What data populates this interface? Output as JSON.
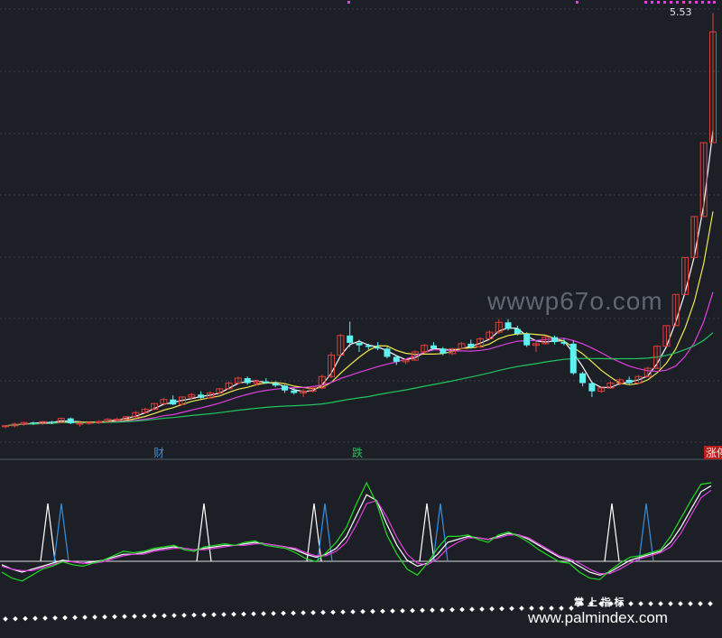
{
  "chart_data": [
    {
      "type": "candlestick",
      "price_label": "5.53",
      "event_labels": [
        {
          "text": "财",
          "color": "#3a8fd8"
        },
        {
          "text": "跌",
          "color": "#22c55e"
        },
        {
          "text": "涨停",
          "color": "#f2f2f2",
          "bg": "#b91c1c"
        }
      ],
      "colors": {
        "up": "#e0403a",
        "down": "#5ff0f0",
        "ma_white": "#ffffff",
        "ma_yellow": "#f2e94e",
        "ma_magenta": "#e040e0",
        "ma_green": "#22c55e"
      },
      "grid": true,
      "candles": [
        [
          0.5,
          0.51,
          0.47,
          0.5
        ],
        [
          0.5,
          0.54,
          0.48,
          0.52
        ],
        [
          0.52,
          0.55,
          0.5,
          0.54
        ],
        [
          0.54,
          0.55,
          0.51,
          0.53
        ],
        [
          0.53,
          0.56,
          0.51,
          0.55
        ],
        [
          0.55,
          0.56,
          0.52,
          0.54
        ],
        [
          0.54,
          0.6,
          0.53,
          0.59
        ],
        [
          0.59,
          0.6,
          0.52,
          0.53
        ],
        [
          0.53,
          0.55,
          0.49,
          0.53
        ],
        [
          0.53,
          0.55,
          0.51,
          0.54
        ],
        [
          0.54,
          0.57,
          0.52,
          0.55
        ],
        [
          0.55,
          0.59,
          0.54,
          0.58
        ],
        [
          0.58,
          0.6,
          0.57,
          0.58
        ],
        [
          0.58,
          0.62,
          0.58,
          0.61
        ],
        [
          0.61,
          0.68,
          0.6,
          0.66
        ],
        [
          0.66,
          0.72,
          0.65,
          0.7
        ],
        [
          0.7,
          0.78,
          0.69,
          0.77
        ],
        [
          0.77,
          0.84,
          0.75,
          0.82
        ],
        [
          0.82,
          0.87,
          0.75,
          0.76
        ],
        [
          0.76,
          0.86,
          0.75,
          0.85
        ],
        [
          0.85,
          0.9,
          0.82,
          0.88
        ],
        [
          0.88,
          0.92,
          0.83,
          0.84
        ],
        [
          0.84,
          0.92,
          0.83,
          0.9
        ],
        [
          0.9,
          0.96,
          0.89,
          0.95
        ],
        [
          0.95,
          1.04,
          0.94,
          1.02
        ],
        [
          1.02,
          1.1,
          1.01,
          1.08
        ],
        [
          1.08,
          1.1,
          1.0,
          1.02
        ],
        [
          1.02,
          1.06,
          0.99,
          1.04
        ],
        [
          1.04,
          1.08,
          1.01,
          1.02
        ],
        [
          1.02,
          1.04,
          0.97,
          0.99
        ],
        [
          0.99,
          1.0,
          0.9,
          0.93
        ],
        [
          0.93,
          0.96,
          0.88,
          0.9
        ],
        [
          0.9,
          0.95,
          0.85,
          0.92
        ],
        [
          0.92,
          0.98,
          0.91,
          0.96
        ],
        [
          0.96,
          1.12,
          0.95,
          1.1
        ],
        [
          1.1,
          1.4,
          1.08,
          1.36
        ],
        [
          1.36,
          1.62,
          1.35,
          1.6
        ],
        [
          1.6,
          1.77,
          1.46,
          1.51
        ],
        [
          1.51,
          1.55,
          1.4,
          1.48
        ],
        [
          1.48,
          1.5,
          1.43,
          1.46
        ],
        [
          1.46,
          1.52,
          1.42,
          1.44
        ],
        [
          1.44,
          1.46,
          1.32,
          1.34
        ],
        [
          1.34,
          1.36,
          1.24,
          1.28
        ],
        [
          1.28,
          1.32,
          1.25,
          1.3
        ],
        [
          1.3,
          1.42,
          1.29,
          1.4
        ],
        [
          1.4,
          1.5,
          1.38,
          1.48
        ],
        [
          1.48,
          1.52,
          1.43,
          1.44
        ],
        [
          1.44,
          1.46,
          1.36,
          1.38
        ],
        [
          1.38,
          1.45,
          1.36,
          1.44
        ],
        [
          1.44,
          1.52,
          1.43,
          1.5
        ],
        [
          1.5,
          1.55,
          1.44,
          1.46
        ],
        [
          1.46,
          1.58,
          1.45,
          1.56
        ],
        [
          1.56,
          1.66,
          1.55,
          1.64
        ],
        [
          1.64,
          1.8,
          1.62,
          1.76
        ],
        [
          1.76,
          1.8,
          1.66,
          1.68
        ],
        [
          1.68,
          1.72,
          1.6,
          1.62
        ],
        [
          1.62,
          1.64,
          1.46,
          1.48
        ],
        [
          1.48,
          1.52,
          1.4,
          1.5
        ],
        [
          1.5,
          1.6,
          1.49,
          1.58
        ],
        [
          1.58,
          1.6,
          1.49,
          1.52
        ],
        [
          1.52,
          1.56,
          1.48,
          1.5
        ],
        [
          1.5,
          1.54,
          1.12,
          1.14
        ],
        [
          1.14,
          1.16,
          0.98,
          1.02
        ],
        [
          1.02,
          1.04,
          0.85,
          0.92
        ],
        [
          0.92,
          0.98,
          0.9,
          0.96
        ],
        [
          0.96,
          1.04,
          0.95,
          1.02
        ],
        [
          1.02,
          1.08,
          0.99,
          1.06
        ],
        [
          1.06,
          1.1,
          1.0,
          1.02
        ],
        [
          1.02,
          1.12,
          1.01,
          1.1
        ],
        [
          1.1,
          1.22,
          1.09,
          1.2
        ],
        [
          1.2,
          1.48,
          1.19,
          1.47
        ],
        [
          1.47,
          1.72,
          1.47,
          1.72
        ],
        [
          1.72,
          2.1,
          1.72,
          2.1
        ],
        [
          2.1,
          2.55,
          2.1,
          2.55
        ],
        [
          2.55,
          3.05,
          2.55,
          3.05
        ],
        [
          3.05,
          3.95,
          3.05,
          3.95
        ],
        [
          3.95,
          5.53,
          3.95,
          5.3
        ]
      ],
      "kdj": {
        "k": [
          45,
          42,
          40,
          42,
          44,
          46,
          48,
          47,
          46,
          47,
          48,
          50,
          52,
          52,
          53,
          55,
          56,
          57,
          56,
          55,
          56,
          57,
          58,
          58,
          59,
          60,
          59,
          58,
          57,
          55,
          52,
          50,
          52,
          56,
          64,
          78,
          92,
          88,
          72,
          58,
          48,
          44,
          46,
          52,
          60,
          62,
          64,
          63,
          62,
          64,
          66,
          65,
          62,
          58,
          54,
          50,
          48,
          44,
          40,
          38,
          40,
          44,
          48,
          50,
          52,
          54,
          60,
          70,
          82,
          94,
          98
        ],
        "d": [
          44,
          42,
          41,
          41,
          43,
          45,
          47,
          47,
          46,
          46,
          47,
          49,
          51,
          52,
          52,
          54,
          55,
          56,
          56,
          55,
          55,
          56,
          57,
          58,
          58,
          59,
          59,
          58,
          57,
          56,
          53,
          51,
          51,
          54,
          60,
          72,
          86,
          88,
          77,
          63,
          52,
          46,
          45,
          49,
          56,
          60,
          63,
          63,
          62,
          63,
          65,
          65,
          63,
          59,
          55,
          51,
          49,
          46,
          42,
          39,
          39,
          42,
          46,
          49,
          51,
          53,
          57,
          66,
          78,
          90,
          95
        ],
        "j": [
          40,
          36,
          34,
          38,
          42,
          44,
          47,
          45,
          44,
          46,
          48,
          51,
          54,
          53,
          54,
          56,
          57,
          58,
          55,
          54,
          57,
          58,
          59,
          58,
          60,
          61,
          58,
          57,
          56,
          53,
          49,
          47,
          53,
          60,
          70,
          86,
          100,
          86,
          65,
          52,
          42,
          38,
          46,
          56,
          64,
          64,
          65,
          62,
          60,
          65,
          67,
          64,
          60,
          55,
          51,
          47,
          46,
          40,
          36,
          35,
          41,
          46,
          50,
          51,
          53,
          55,
          64,
          76,
          88,
          99,
          100
        ]
      }
    }
  ],
  "watermarks": {
    "center": "wwwp67o.com",
    "brand_cn": "掌 上 指 标",
    "brand_url": "www.palmindex.com"
  }
}
